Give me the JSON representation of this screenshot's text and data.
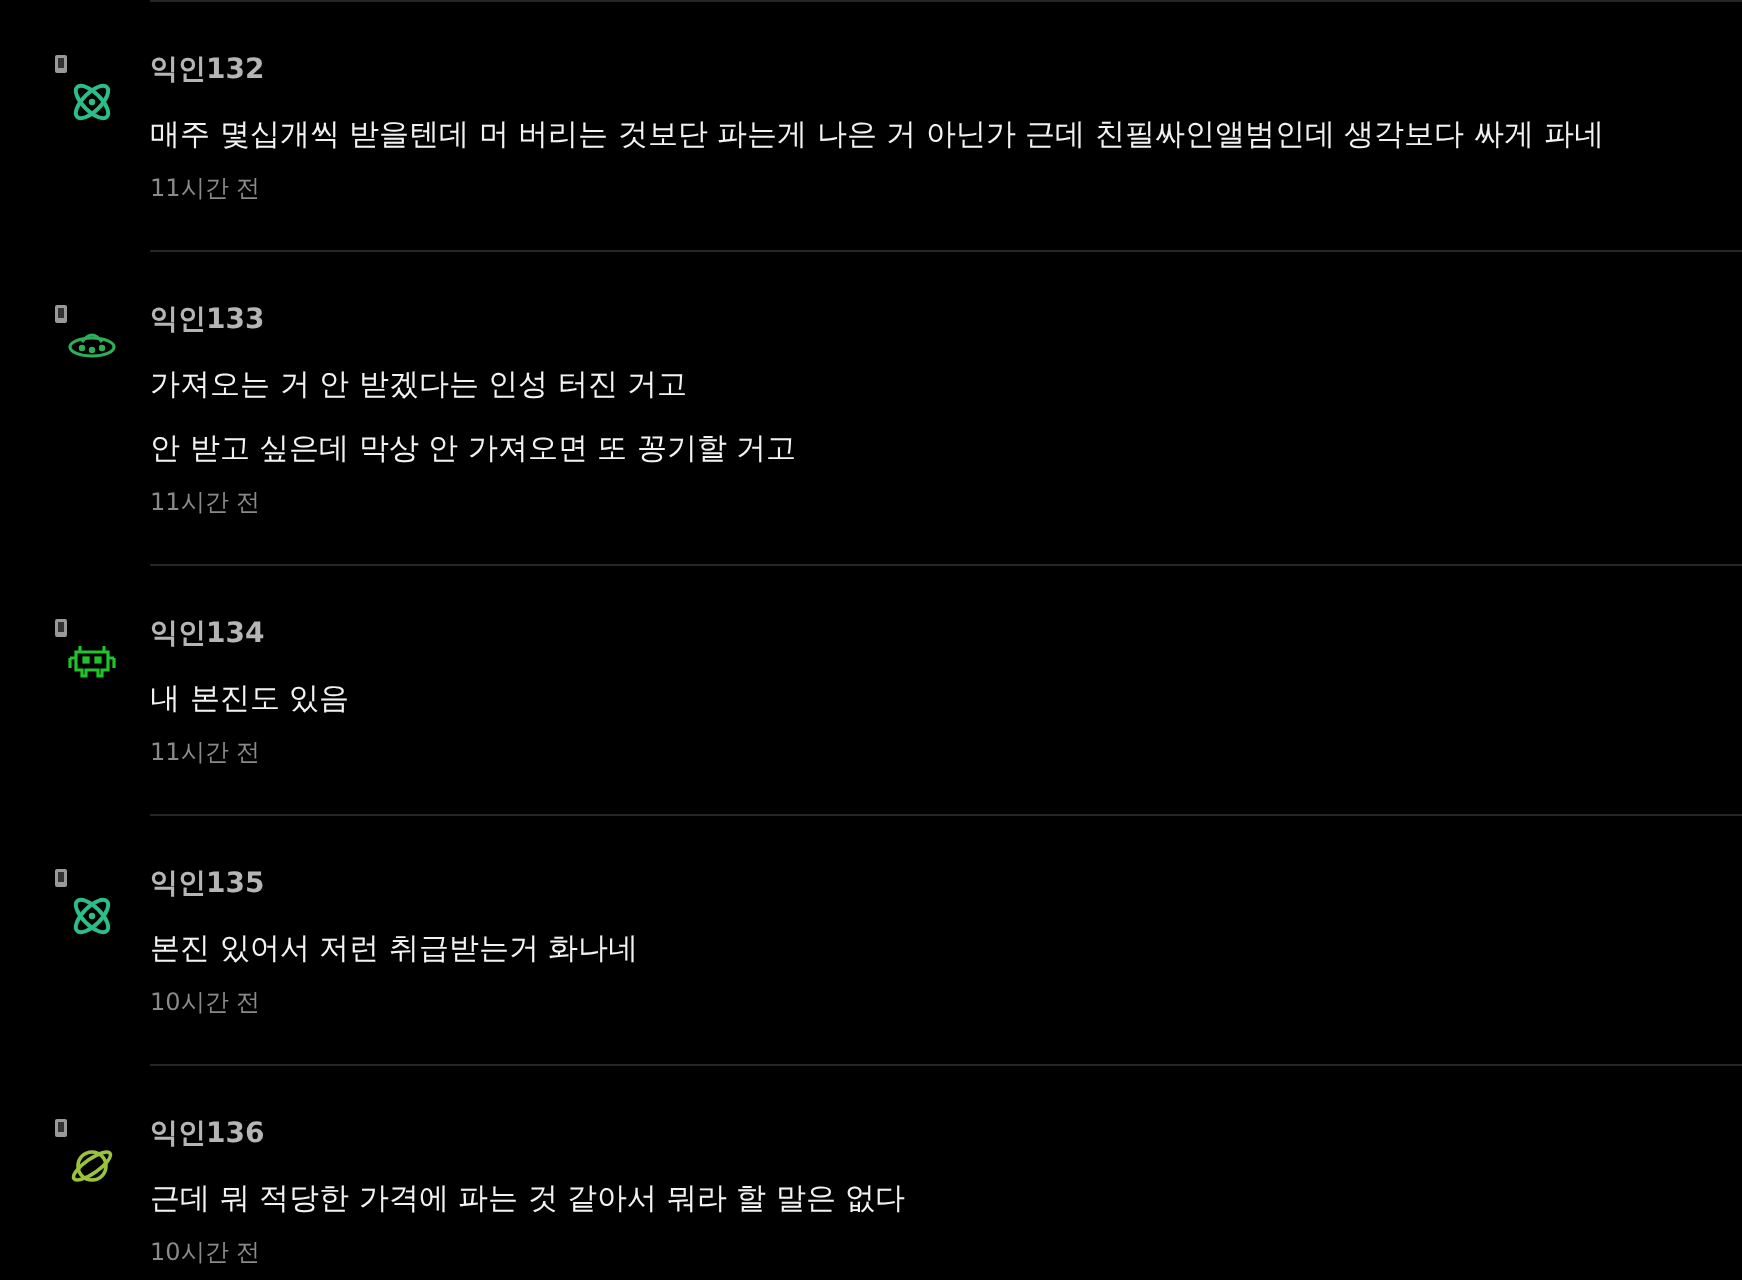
{
  "comments": [
    {
      "author": "익인132",
      "kind": "atom",
      "color": "#2bbd8a",
      "mobile": true,
      "lines": [
        "매주 몇십개씩 받을텐데 머 버리는 것보단 파는게 나은 거 아닌가 근데 친필싸인앨범인데 생각보다 싸게 파네"
      ],
      "time": "11시간 전"
    },
    {
      "author": "익인133",
      "kind": "ufo",
      "color": "#2eae5a",
      "mobile": true,
      "lines": [
        "가져오는 거 안 받겠다는 인성 터진 거고",
        "안 받고 싶은데 막상 안 가져오면 또 꽁기할 거고"
      ],
      "time": "11시간 전"
    },
    {
      "author": "익인134",
      "kind": "invader",
      "color": "#22c22a",
      "mobile": true,
      "lines": [
        "내 본진도 있음"
      ],
      "time": "11시간 전"
    },
    {
      "author": "익인135",
      "kind": "atom",
      "color": "#2bbd8a",
      "mobile": true,
      "lines": [
        "본진 있어서 저런 취급받는거 화나네"
      ],
      "time": "10시간 전"
    },
    {
      "author": "익인136",
      "kind": "planet",
      "color": "#9ac23c",
      "mobile": true,
      "lines": [
        "근데 뭐 적당한 가격에 파는 것 같아서 뭐라 할 말은 없다"
      ],
      "time": "10시간 전"
    }
  ]
}
